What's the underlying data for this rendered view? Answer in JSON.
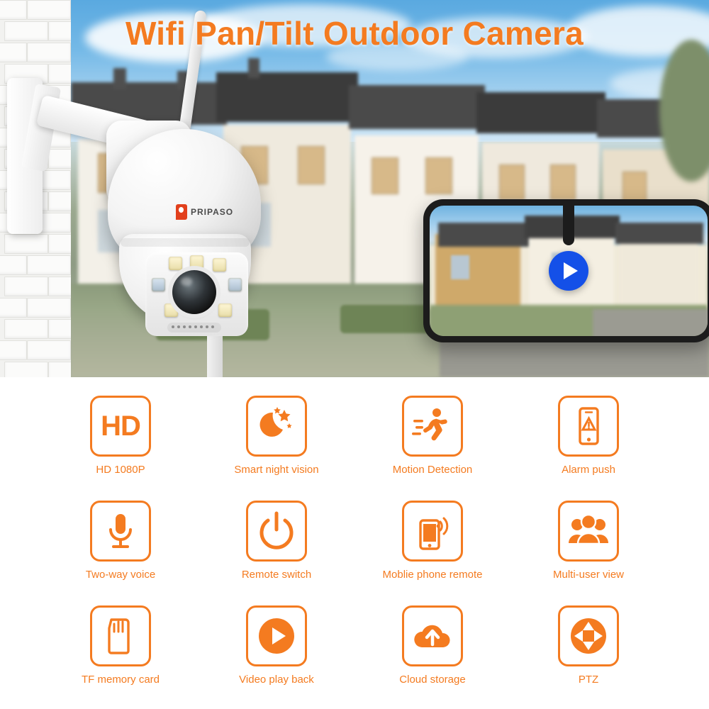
{
  "hero": {
    "title": "Wifi Pan/Tilt Outdoor Camera",
    "brand_name": "PRIPASO",
    "brand_mark_icon": "pripaso-logo-icon",
    "camera_icon": "outdoor-ptz-camera",
    "phone_icon": "smartphone-live-view",
    "play_button_icon": "play-icon",
    "accent_color": "#f47b20",
    "play_button_color": "#1450e8"
  },
  "features": [
    {
      "id": "hd-1080p",
      "label": "HD 1080P",
      "icon": "hd-text-icon"
    },
    {
      "id": "smart-night-vision",
      "label": "Smart night vision",
      "icon": "moon-stars-icon"
    },
    {
      "id": "motion-detection",
      "label": "Motion Detection",
      "icon": "running-person-icon"
    },
    {
      "id": "alarm-push",
      "label": "Alarm push",
      "icon": "phone-alert-icon"
    },
    {
      "id": "two-way-voice",
      "label": "Two-way voice",
      "icon": "microphone-icon"
    },
    {
      "id": "remote-switch",
      "label": "Remote switch",
      "icon": "power-icon"
    },
    {
      "id": "mobile-phone-remote",
      "label": "Moblie phone remote",
      "icon": "phone-wifi-icon"
    },
    {
      "id": "multi-user-view",
      "label": "Multi-user view",
      "icon": "group-people-icon"
    },
    {
      "id": "tf-memory-card",
      "label": "TF memory card",
      "icon": "memory-card-icon"
    },
    {
      "id": "video-play-back",
      "label": "Video play back",
      "icon": "play-circle-icon"
    },
    {
      "id": "cloud-storage",
      "label": "Cloud storage",
      "icon": "cloud-upload-icon"
    },
    {
      "id": "ptz",
      "label": "PTZ",
      "icon": "dpad-arrows-icon"
    }
  ]
}
